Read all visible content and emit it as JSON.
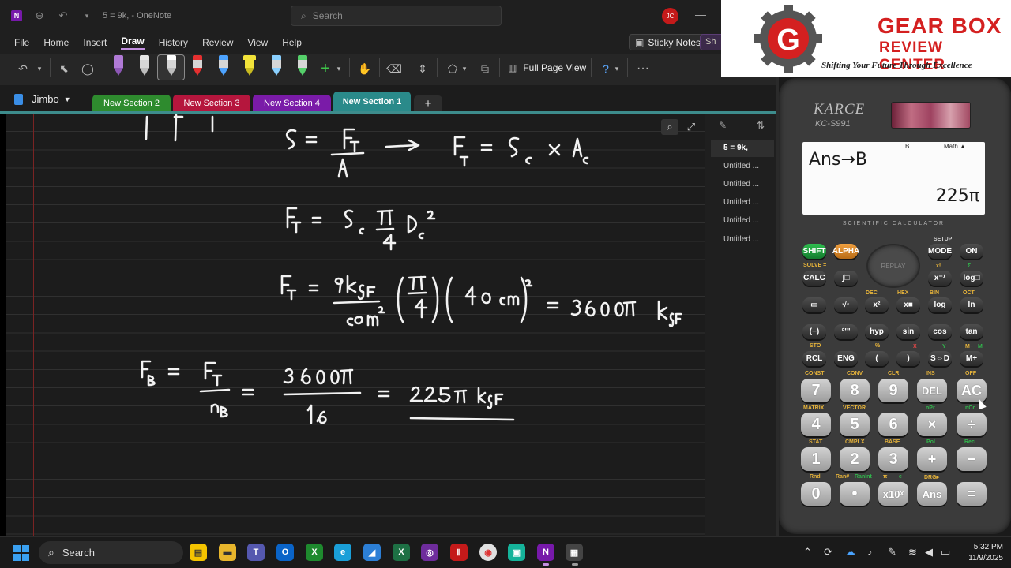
{
  "window": {
    "title": "5 = 9k,  -  OneNote",
    "search_placeholder": "Search",
    "user_initials": "JC",
    "minimize_glyph": "—"
  },
  "menu": {
    "items": [
      "File",
      "Home",
      "Insert",
      "Draw",
      "History",
      "Review",
      "View",
      "Help"
    ],
    "active": "Draw",
    "sticky_notes": "Sticky Notes",
    "share_stub": "Sh"
  },
  "ribbon": {
    "full_page_view": "Full Page View",
    "more": "···",
    "pens": [
      {
        "name": "pen-purple",
        "color": "#b07ad6"
      },
      {
        "name": "pen-white",
        "color": "#e6e6e6"
      },
      {
        "name": "pen-white-selected",
        "color": "#ffffff"
      },
      {
        "name": "pen-red",
        "color": "#e53030"
      },
      {
        "name": "pen-blue",
        "color": "#4da3ff"
      },
      {
        "name": "pen-yellow",
        "color": "#f2e33a"
      },
      {
        "name": "pen-lightblue",
        "color": "#8ad0ff"
      },
      {
        "name": "pen-green",
        "color": "#55d06a"
      }
    ]
  },
  "notebook": {
    "name": "Jimbo",
    "tabs": [
      {
        "label": "New Section 2",
        "color": "#2e8b2e",
        "active": false
      },
      {
        "label": "New Section 3",
        "color": "#b5163d",
        "active": false
      },
      {
        "label": "New Section 4",
        "color": "#7a1ba8",
        "active": false
      },
      {
        "label": "New Section 1",
        "color": "#2a8a8a",
        "active": true
      }
    ],
    "add_tab": "+"
  },
  "pages": [
    {
      "title": "5 = 9k,",
      "selected": true
    },
    {
      "title": "Untitled ...",
      "selected": false
    },
    {
      "title": "Untitled ...",
      "selected": false
    },
    {
      "title": "Untitled ...",
      "selected": false
    },
    {
      "title": "Untitled ...",
      "selected": false
    },
    {
      "title": "Untitled ...",
      "selected": false
    }
  ],
  "calculator": {
    "brand": "KARCE",
    "model": "KC-S991",
    "label": "SCIENTIFIC CALCULATOR",
    "replay": "REPLAY",
    "display": {
      "input": "Ans→B",
      "output": "225π",
      "indicator_math": "Math ▲",
      "indicator_b": "B"
    },
    "top_keys": [
      {
        "label": "SHIFT",
        "style": "shift"
      },
      {
        "label": "ALPHA",
        "style": "alpha"
      },
      {
        "label": "MODE",
        "style": "normal"
      },
      {
        "label": "ON",
        "style": "normal"
      },
      {
        "label": "CALC",
        "style": "normal"
      },
      {
        "label": "∫□",
        "style": "normal"
      },
      {
        "label": "x⁻¹",
        "style": "normal"
      },
      {
        "label": "log□",
        "style": "normal"
      },
      {
        "label": "▭",
        "style": "normal"
      },
      {
        "label": "√▫",
        "style": "normal"
      },
      {
        "label": "x²",
        "style": "normal"
      },
      {
        "label": "x■",
        "style": "normal"
      },
      {
        "label": "log",
        "style": "normal"
      },
      {
        "label": "ln",
        "style": "normal"
      },
      {
        "label": "(−)",
        "style": "normal"
      },
      {
        "label": "°'\"",
        "style": "normal"
      },
      {
        "label": "hyp",
        "style": "normal"
      },
      {
        "label": "sin",
        "style": "normal"
      },
      {
        "label": "cos",
        "style": "normal"
      },
      {
        "label": "tan",
        "style": "normal"
      },
      {
        "label": "RCL",
        "style": "normal"
      },
      {
        "label": "ENG",
        "style": "normal"
      },
      {
        "label": "(",
        "style": "normal"
      },
      {
        "label": ")",
        "style": "normal"
      },
      {
        "label": "S⇔D",
        "style": "normal"
      },
      {
        "label": "M+",
        "style": "normal"
      }
    ],
    "num_keys": [
      "7",
      "8",
      "9",
      "DEL",
      "AC",
      "4",
      "5",
      "6",
      "×",
      "÷",
      "1",
      "2",
      "3",
      "+",
      "−",
      "0",
      "•",
      "x10ˣ",
      "Ans",
      "="
    ],
    "sub_labels": [
      "SETUP",
      "SOLVE =",
      "x!",
      "Σ",
      "DEC",
      "HEX",
      "BIN",
      "OCT",
      "STO",
      "%",
      "CONST",
      "CONV",
      "CLR",
      "INS",
      "OFF",
      "MATRIX",
      "VECTOR",
      "nPr",
      "nCr",
      "STAT",
      "CMPLX",
      "BASE",
      "Pol",
      "Rec",
      "Rnd",
      "Ran#",
      "RanInt",
      "π",
      "e",
      "DRG▸",
      "M−",
      "M",
      "Y",
      "X"
    ]
  },
  "logo": {
    "line1": "GEAR BOX",
    "line2": "REVIEW CENTER",
    "tagline": "Shifting Your Future Through Excellence",
    "letter": "G"
  },
  "taskbar": {
    "search": "Search",
    "time": "5:32 PM",
    "date": "11/9/2025"
  }
}
